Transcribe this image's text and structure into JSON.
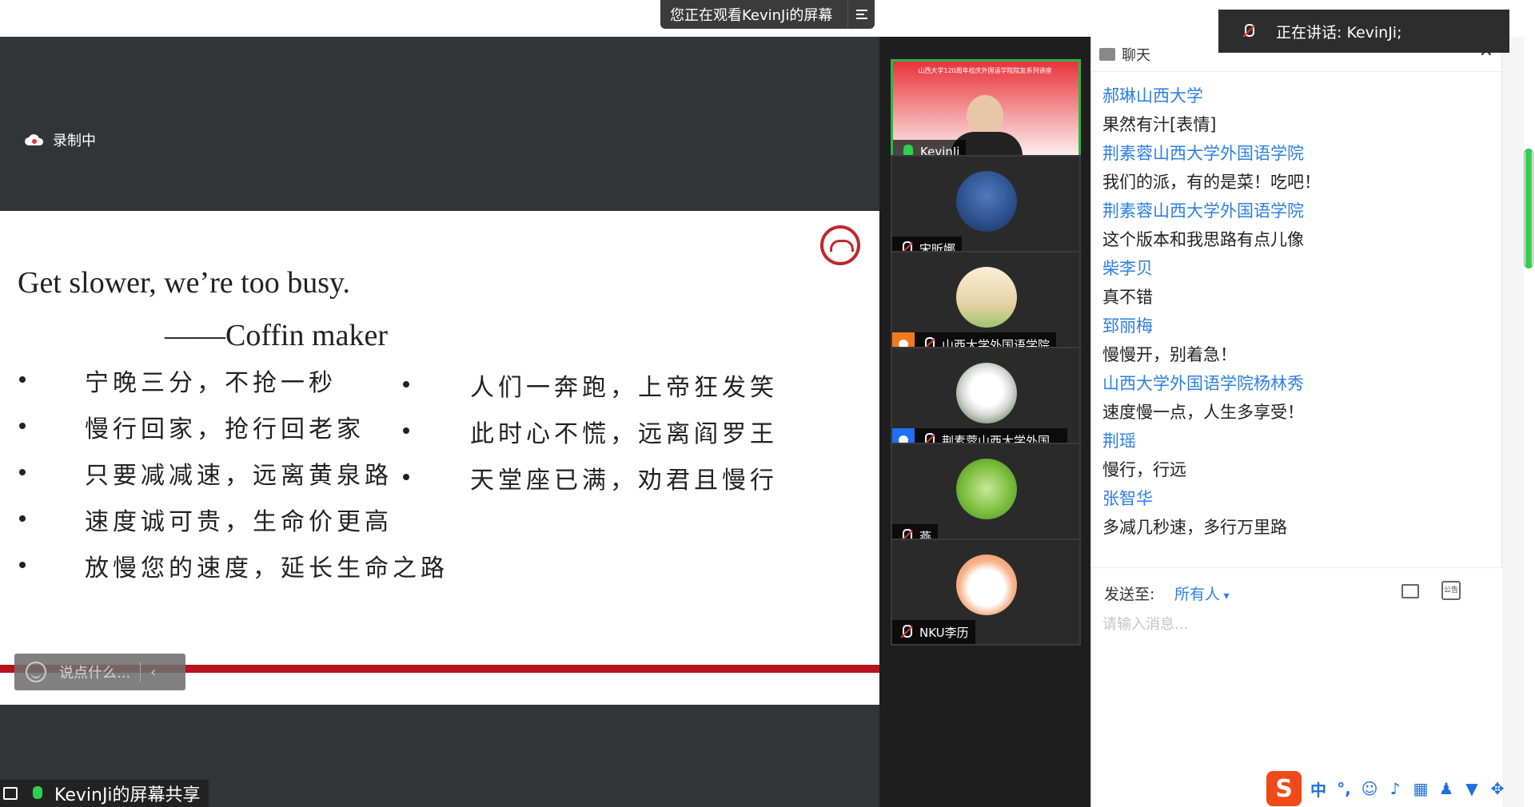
{
  "top_banner": {
    "viewing_text": "您正在观看KevinJi的屏幕"
  },
  "share": {
    "recording_label": "录制中",
    "screen_share_label": "KevinJi的屏幕共享",
    "say_something_placeholder": "说点什么...",
    "slide": {
      "title": "Get slower, we’re too busy.",
      "author": "——Coffin maker",
      "left_bullets": [
        "宁晚三分，不抢一秒",
        "慢行回家，抢行回老家",
        "只要减减速，远离黄泉路",
        "速度诚可贵，生命价更高",
        "放慢您的速度，延长生命之路"
      ],
      "right_bullets": [
        "人们一奔跑，上帝狂发笑",
        "此时心不慌，远离阎罗王",
        "天堂座已满，劝君且慢行"
      ],
      "accent_color": "#b8121b"
    }
  },
  "participants": [
    {
      "name": "KevinJi",
      "mic": "on",
      "video_banner": "山西大学120周年校庆外国语学院院友系列讲座"
    },
    {
      "name": "宋昕娜",
      "mic": "muted"
    },
    {
      "name": "山西大学外国语学院",
      "mic": "muted"
    },
    {
      "name": "荆素蓉山西大学外国...",
      "mic": "muted"
    },
    {
      "name": "燕",
      "mic": "muted"
    },
    {
      "name": "NKU李历",
      "mic": "muted"
    }
  ],
  "speaking_toast": {
    "text": "正在讲话: KevinJi;"
  },
  "chat": {
    "title": "聊天",
    "more_label": "···",
    "close_label": "✕",
    "messages": [
      {
        "sender": "郝琳山西大学",
        "text": "果然有汁[表情]"
      },
      {
        "sender": "荆素蓉山西大学外国语学院",
        "text": "我们的派，有的是菜！吃吧！"
      },
      {
        "sender": "荆素蓉山西大学外国语学院",
        "text": "这个版本和我思路有点儿像"
      },
      {
        "sender": "柴李贝",
        "text": "真不错"
      },
      {
        "sender": "郅丽梅",
        "text": "慢慢开，别着急！"
      },
      {
        "sender": "山西大学外国语学院杨林秀",
        "text": "速度慢一点，人生多享受！"
      },
      {
        "sender": "荆瑶",
        "text": "慢行，行远"
      },
      {
        "sender": "张智华",
        "text": "多减几秒速，多行万里路"
      }
    ],
    "send_to_label": "发送至:",
    "send_to_target": "所有人",
    "input_placeholder": "请输入消息..."
  },
  "ime": {
    "logo": "S",
    "mode": "中",
    "punct": "°,"
  }
}
